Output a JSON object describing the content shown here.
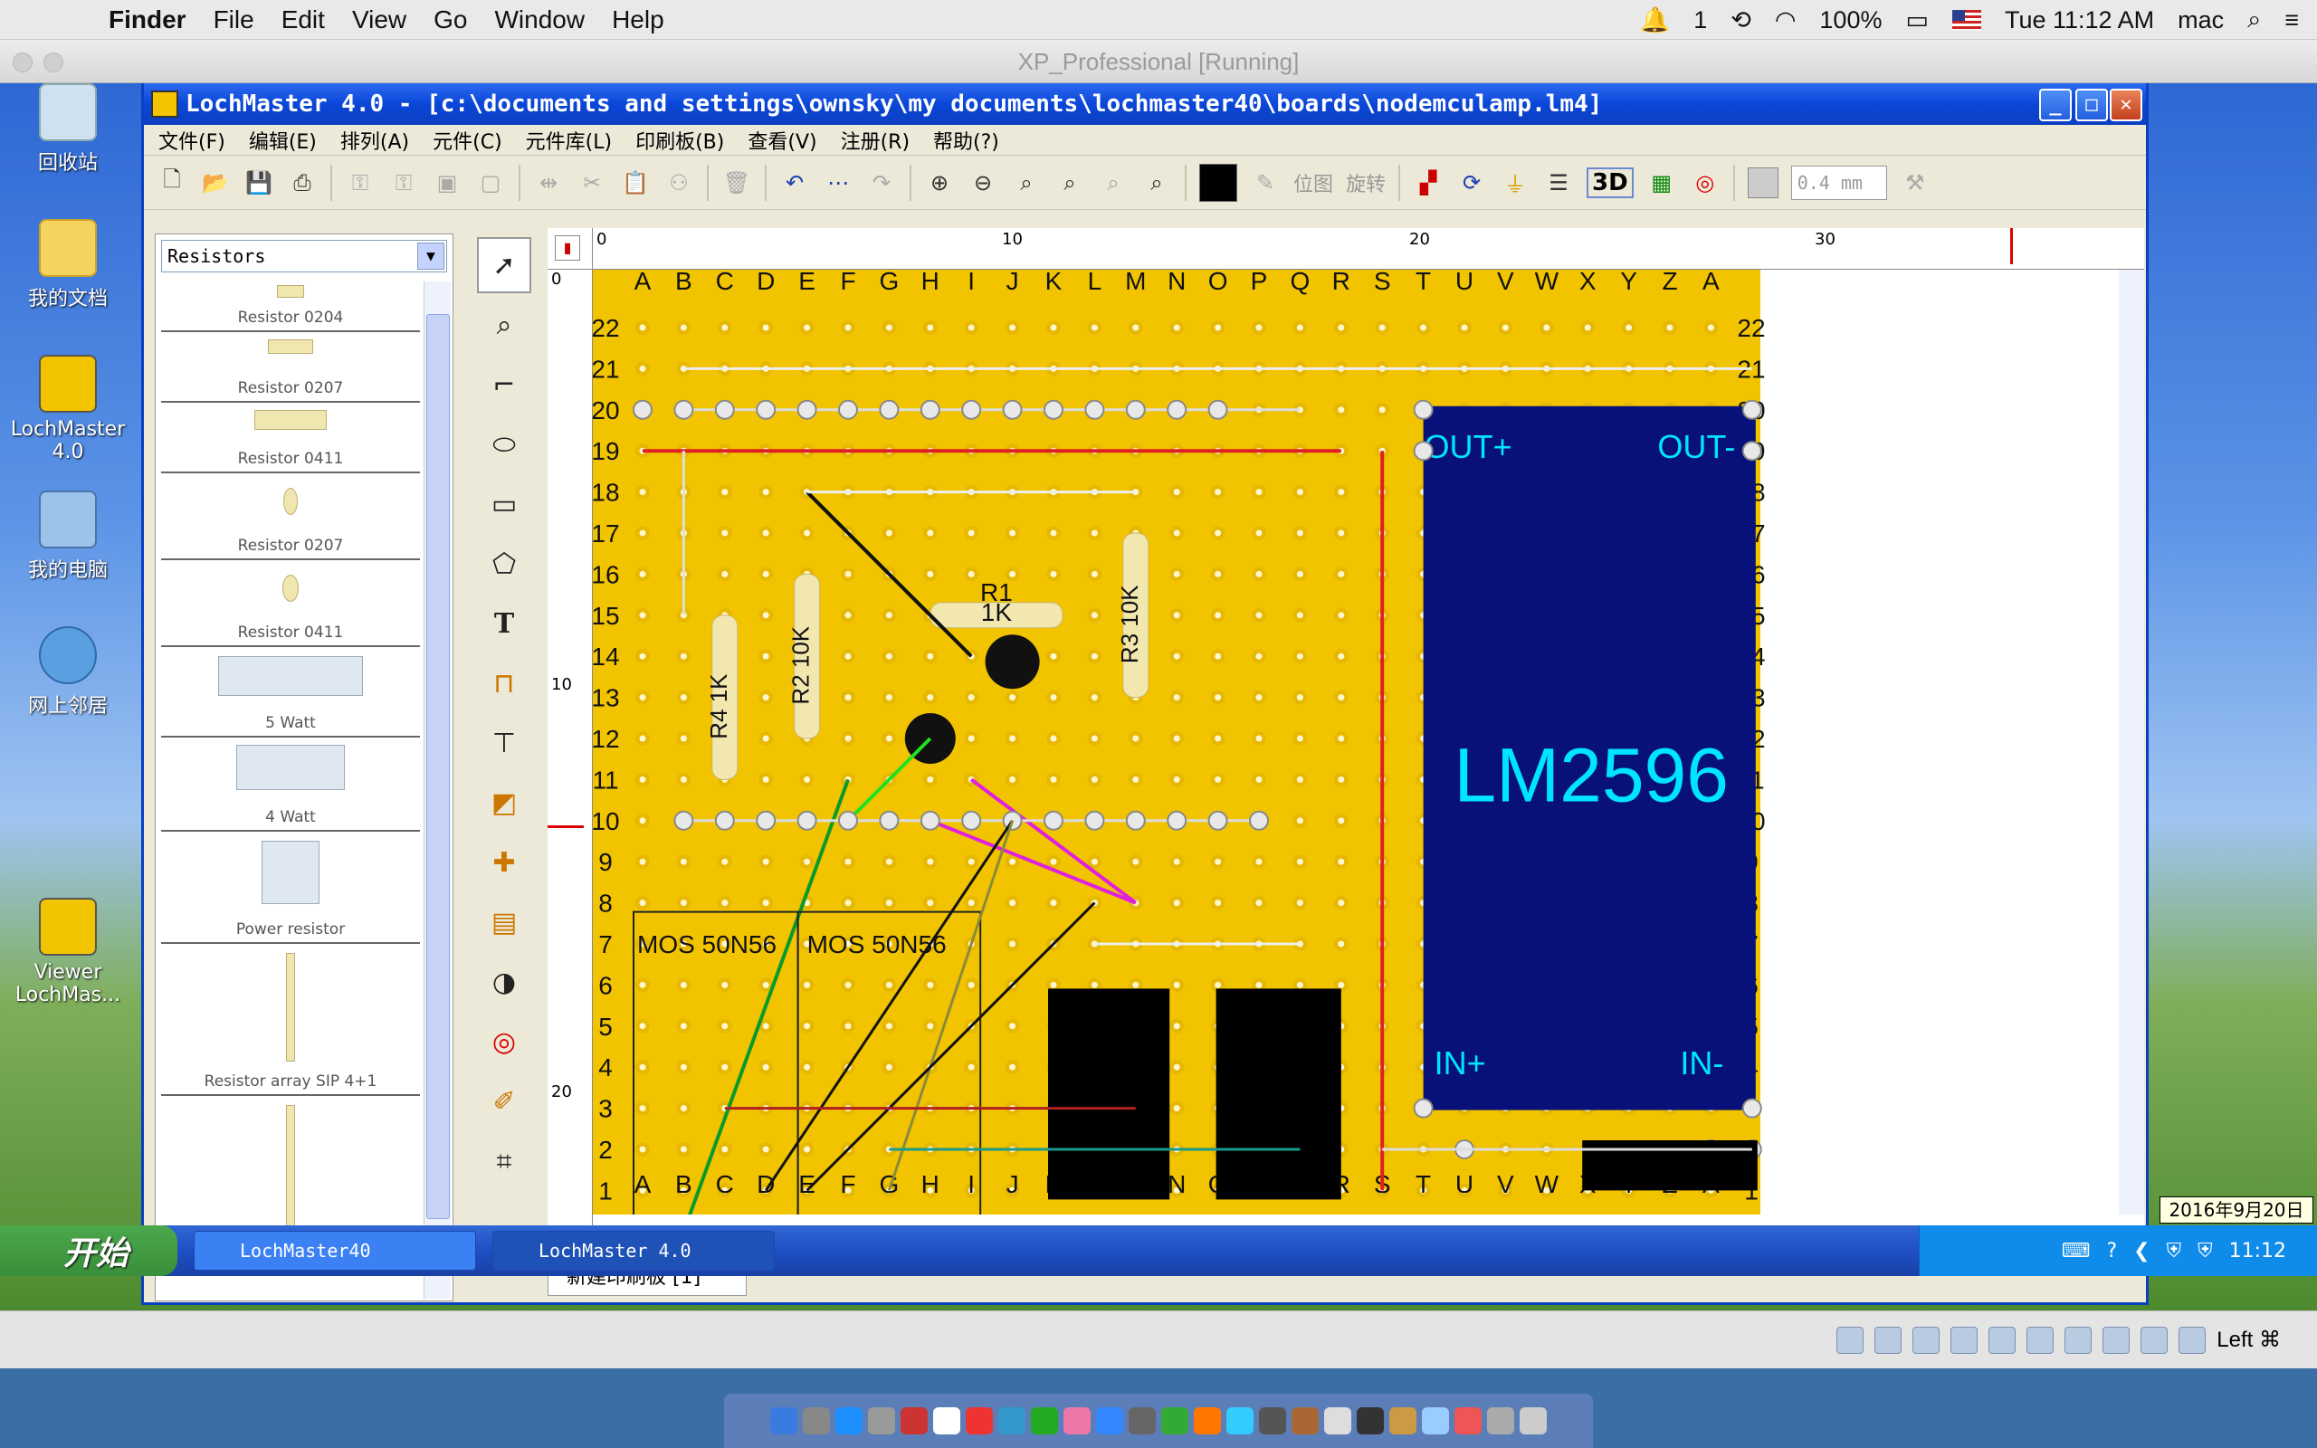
{
  "mac_menubar": {
    "app": "Finder",
    "items": [
      "File",
      "Edit",
      "View",
      "Go",
      "Window",
      "Help"
    ],
    "status_count": "1",
    "battery": "100%",
    "clock": "Tue 11:12 AM",
    "user": "mac"
  },
  "vm": {
    "title": "XP_Professional [Running]",
    "keyboard_hint": "Left ⌘"
  },
  "desktop_icons": [
    "回收站",
    "我的文档",
    "LochMaster 4.0",
    "我的电脑",
    "网上邻居",
    "Viewer LochMas..."
  ],
  "app": {
    "title": "LochMaster 4.0 - [c:\\documents and settings\\ownsky\\my documents\\lochmaster40\\boards\\nodemculamp.lm4]",
    "menu": [
      "文件(F)",
      "编辑(E)",
      "排列(A)",
      "元件(C)",
      "元件库(L)",
      "印刷板(B)",
      "查看(V)",
      "注册(R)",
      "帮助(?)"
    ],
    "toolbar": {
      "pos_label": "位图",
      "rotate_label": "旋转",
      "three_d": "3D",
      "track_width": "0.4 mm"
    },
    "library": {
      "category": "Resistors",
      "items": [
        {
          "label": "Resistor 0204",
          "ref": "R1"
        },
        {
          "label": "Resistor 0207",
          "ref": "R2"
        },
        {
          "label": "Resistor 0411",
          "ref": "R3"
        },
        {
          "label": "Resistor 0207",
          "ref": "R4"
        },
        {
          "label": "Resistor 0411",
          "ref": "R5"
        },
        {
          "label": "5 Watt",
          "ref": "R6"
        },
        {
          "label": "4 Watt",
          "ref": "R7"
        },
        {
          "label": "Power resistor",
          "ref": "R8"
        },
        {
          "label": "Resistor array SIP 4+1",
          "ref": ""
        }
      ]
    },
    "ruler_top": [
      "0",
      "10",
      "20",
      "30"
    ],
    "ruler_left": [
      "0",
      "10",
      "20"
    ],
    "board": {
      "columns": [
        "A",
        "B",
        "C",
        "D",
        "E",
        "F",
        "G",
        "H",
        "I",
        "J",
        "K",
        "L",
        "M",
        "N",
        "O",
        "P",
        "Q",
        "R",
        "S",
        "T",
        "U",
        "V",
        "W",
        "X",
        "Y",
        "Z",
        "A"
      ],
      "rows": [
        "22",
        "21",
        "20",
        "19",
        "18",
        "17",
        "16",
        "15",
        "14",
        "13",
        "12",
        "11",
        "10",
        "9",
        "8",
        "7",
        "6",
        "5",
        "4",
        "3",
        "2",
        "1"
      ],
      "module_label": "LM2596",
      "out_plus": "OUT+",
      "out_minus": "OUT-",
      "in_plus": "IN+",
      "in_minus": "IN-",
      "mos1": "MOS 50N56",
      "mos2": "MOS 50N56",
      "r1": "R1",
      "r1_val": "1K",
      "r2": "R2",
      "r2_val": "10K",
      "r3": "R3",
      "r3_val": "10K",
      "r4": "R4",
      "r4_val": "1K",
      "board_color": "#f2c400",
      "module_color": "#08107a"
    },
    "board_tab": "新建印刷板 [1]"
  },
  "taskbar": {
    "start": "开始",
    "tasks": [
      "LochMaster40",
      "LochMaster 4.0"
    ],
    "clock": "11:12",
    "date_tooltip": "2016年9月20日"
  }
}
